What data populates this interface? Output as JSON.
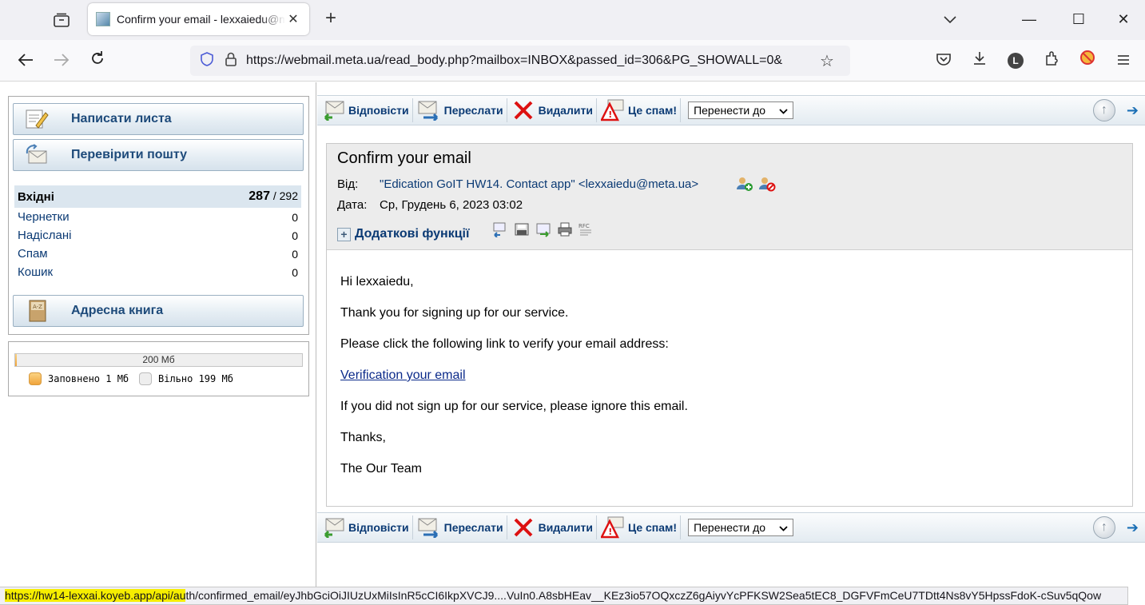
{
  "browser": {
    "tab_title": "Confirm your email - lexxaiedu@meta.ua",
    "new_tab_symbol": "+",
    "tab_close_symbol": "✕",
    "url": "https://webmail.meta.ua/read_body.php?mailbox=INBOX&passed_id=306&PG_SHOWALL=0&",
    "profile_initial": "L",
    "window_controls": {
      "minimize": "—",
      "maximize": "☐",
      "close": "✕"
    },
    "icons": [
      "tab-list-icon",
      "back-icon",
      "forward-icon",
      "reload-icon",
      "shield-icon",
      "lock-icon",
      "star-icon",
      "pocket-icon",
      "download-icon",
      "extensions-icon",
      "blocker-icon",
      "menu-icon"
    ]
  },
  "sidebar": {
    "compose_label": "Написати листа",
    "check_mail_label": "Перевірити пошту",
    "address_book_label": "Адресна книга",
    "folders": [
      {
        "name": "Вхідні",
        "unread": "287",
        "total": "/ 292"
      },
      {
        "name": "Чернетки",
        "count": "0"
      },
      {
        "name": "Надіслані",
        "count": "0"
      },
      {
        "name": "Спам",
        "count": "0"
      },
      {
        "name": "Кошик",
        "count": "0"
      }
    ],
    "quota": {
      "total_label": "200 Мб",
      "used_fraction": 0.005,
      "used_label": "Заповнено 1 Мб",
      "free_label": "Вільно 199 Мб"
    }
  },
  "toolbar": {
    "reply_label": "Відповісти",
    "forward_label": "Переслати",
    "delete_label": "Видалити",
    "spam_label": "Це спам!",
    "move_label": "Перенести до",
    "up_symbol": "↑",
    "next_symbol": "➔"
  },
  "message": {
    "subject": "Confirm your email",
    "from_key": "Від:",
    "from_value": "\"Edication GoIT HW14. Contact app\" <lexxaiedu@meta.ua>",
    "date_key": "Дата:",
    "date_value": "Ср, Грудень 6, 2023 03:02",
    "extra_functions_label": "Додаткові функції",
    "body": {
      "greeting": "Hi lexxaiedu,",
      "thanks_line": "Thank you for signing up for our service.",
      "instruction": "Please click the following link to verify your email address:",
      "link_text": "Verification your email",
      "ignore_line": "If you did not sign up for our service, please ignore this email.",
      "closing": "Thanks,",
      "signature": "The Our Team"
    }
  },
  "status_bar": {
    "url_highlighted": "https://hw14-lexxai.koyeb.app/api/au",
    "url_rest": "th/confirmed_email/eyJhbGciOiJIUzUxMiIsInR5cCI6IkpXVCJ9....VuIn0.A8sbHEav__KEz3io57OQxczZ6gAiyvYcPFKSW2Sea5tEC8_DGFVFmCeU7TDtt4Ns8vY5HpssFdoK-cSuv5qQow"
  },
  "colors": {
    "highlight": "#f6ee00",
    "link_blue": "#0b3a74",
    "quota_used": "#f0a43b"
  }
}
